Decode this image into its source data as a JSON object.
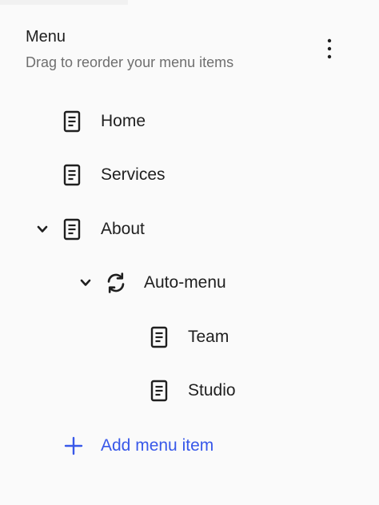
{
  "header": {
    "title": "Menu",
    "subtitle": "Drag to reorder your menu items",
    "more_icon": "more-vertical-icon"
  },
  "menu": {
    "items": [
      {
        "label": "Home",
        "icon": "page-icon"
      },
      {
        "label": "Services",
        "icon": "page-icon"
      },
      {
        "label": "About",
        "icon": "page-icon",
        "expanded": true
      },
      {
        "label": "Auto-menu",
        "icon": "sync-icon",
        "expanded": true
      },
      {
        "label": "Team",
        "icon": "page-icon"
      },
      {
        "label": "Studio",
        "icon": "page-icon"
      }
    ]
  },
  "actions": {
    "add_label": "Add menu item",
    "add_icon": "plus-icon"
  },
  "colors": {
    "accent": "#3858e9",
    "text": "#1f1f1f",
    "muted": "#6f6f6f"
  }
}
